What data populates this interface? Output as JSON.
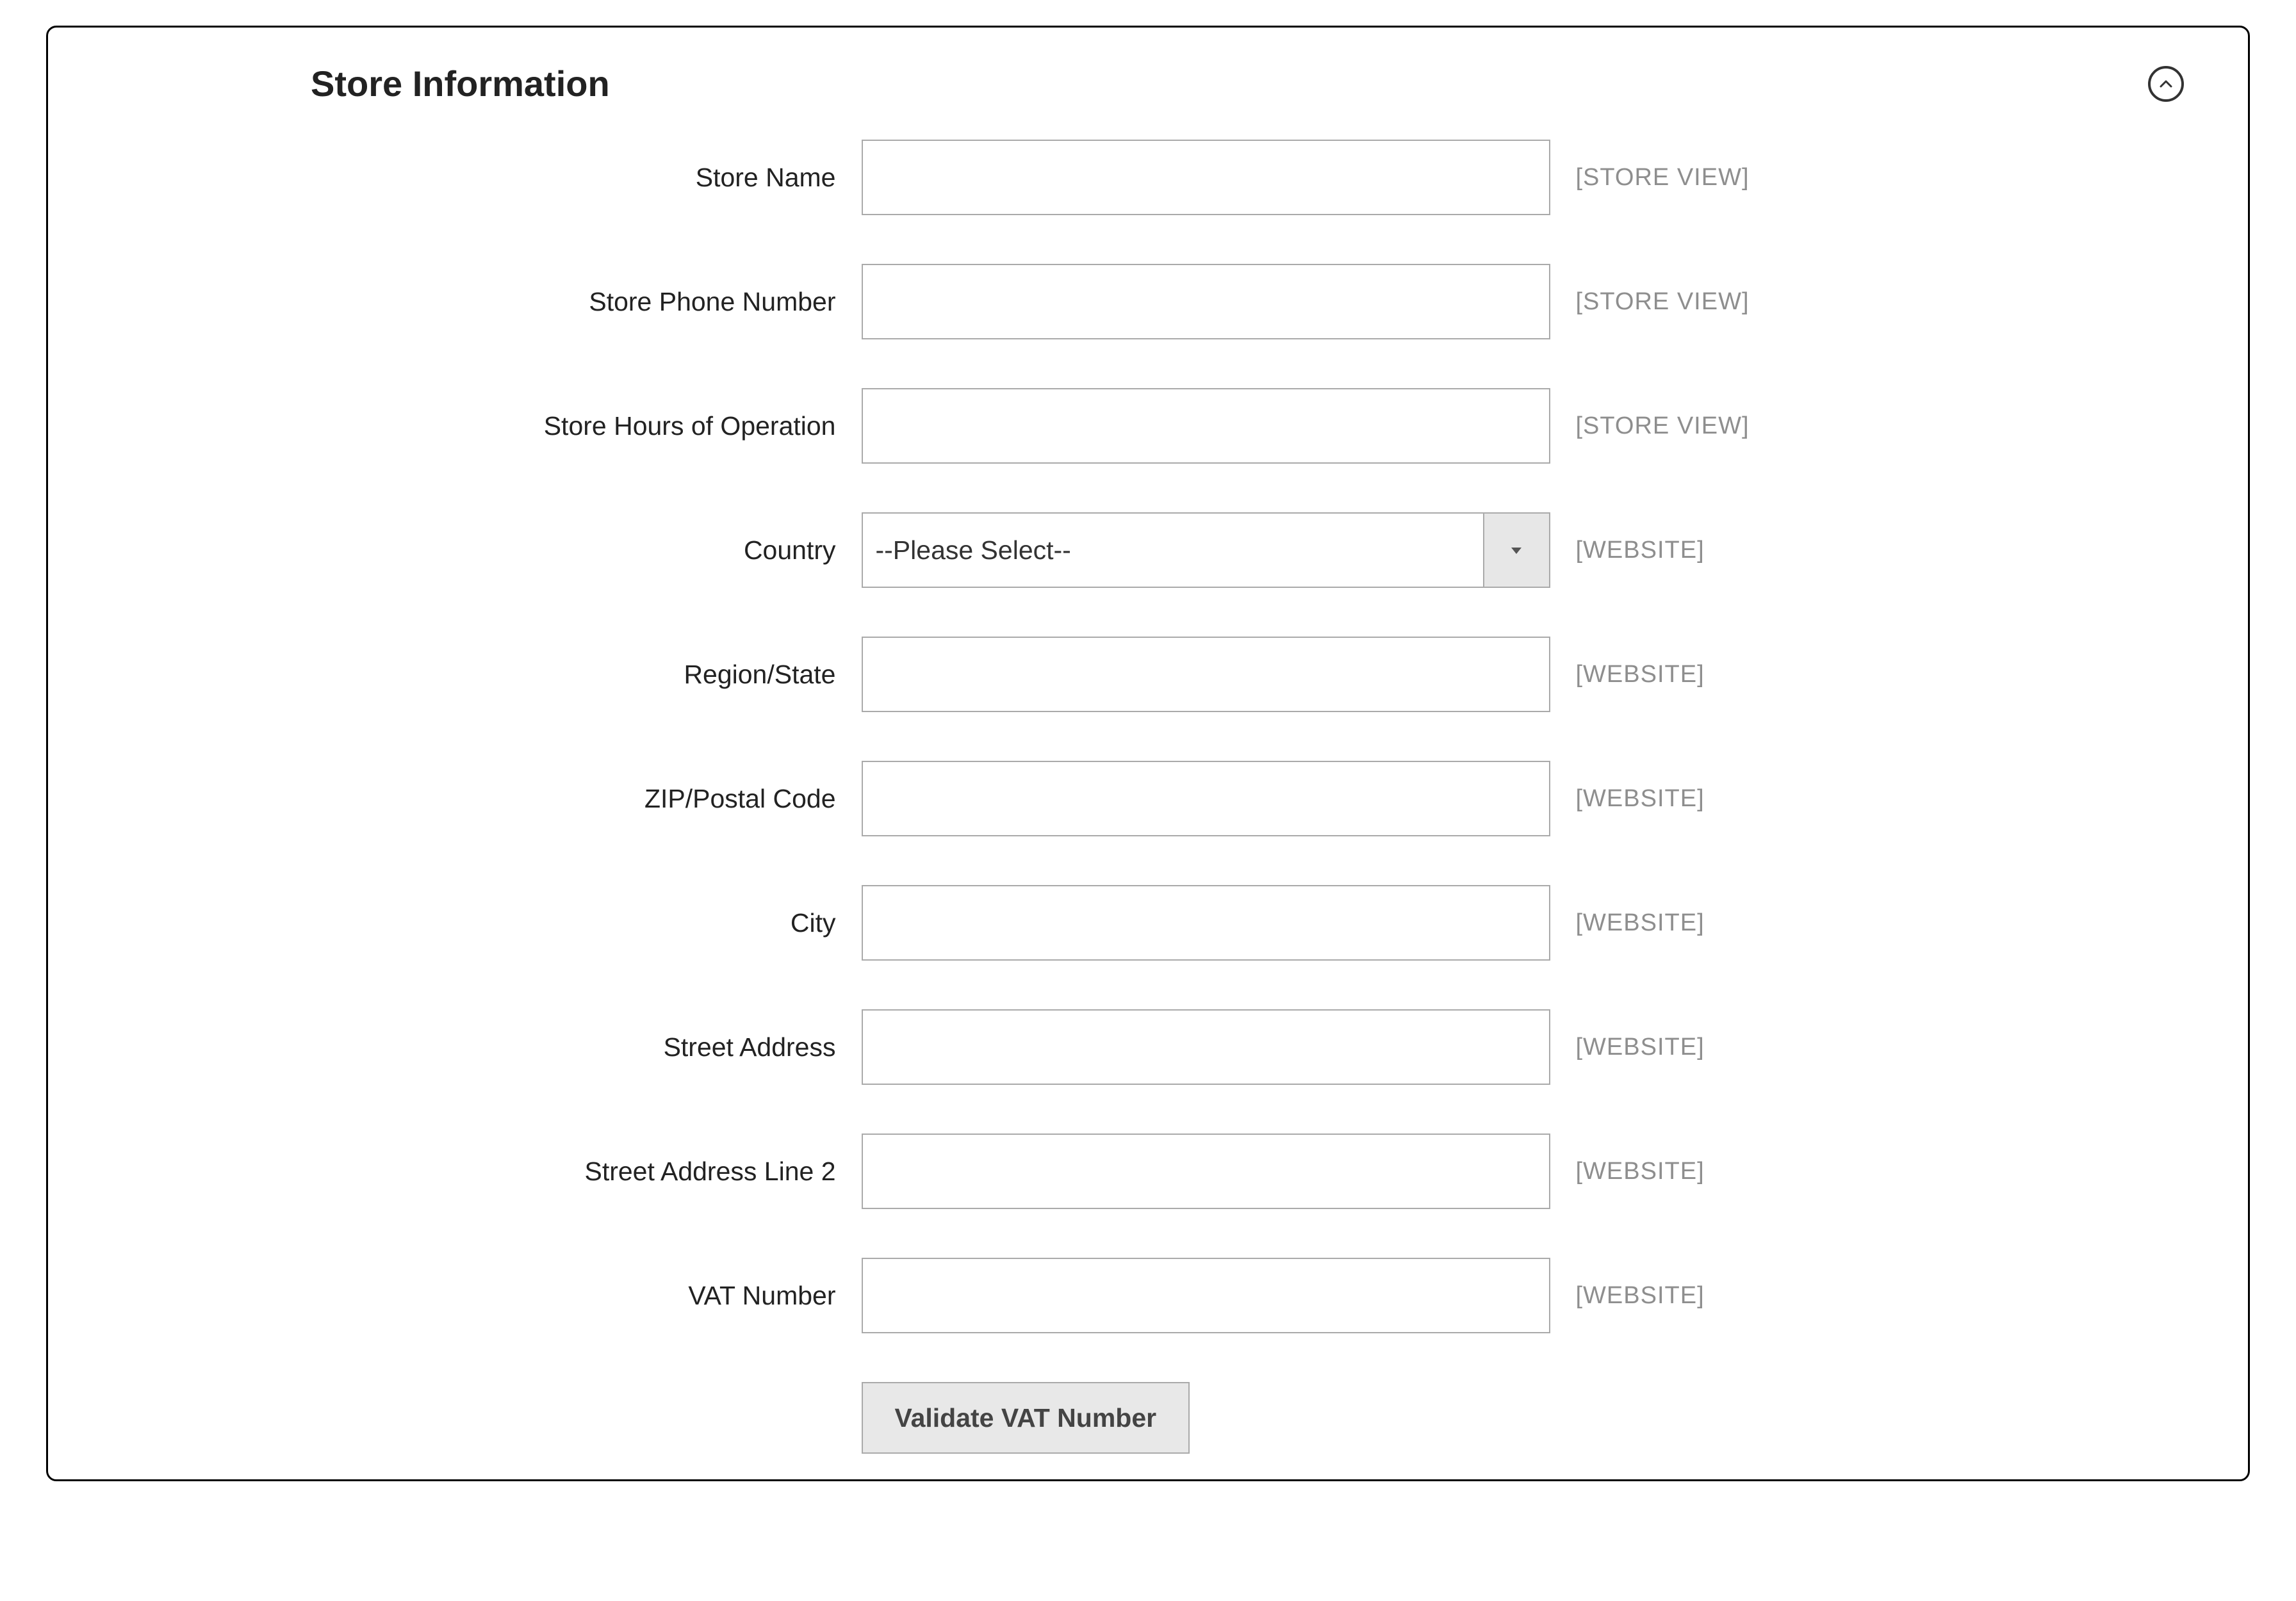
{
  "section": {
    "title": "Store Information"
  },
  "fields": {
    "store_name": {
      "label": "Store Name",
      "value": "",
      "scope": "[STORE VIEW]"
    },
    "store_phone": {
      "label": "Store Phone Number",
      "value": "",
      "scope": "[STORE VIEW]"
    },
    "store_hours": {
      "label": "Store Hours of Operation",
      "value": "",
      "scope": "[STORE VIEW]"
    },
    "country": {
      "label": "Country",
      "value": "--Please Select--",
      "scope": "[WEBSITE]"
    },
    "region_state": {
      "label": "Region/State",
      "value": "",
      "scope": "[WEBSITE]"
    },
    "zip": {
      "label": "ZIP/Postal Code",
      "value": "",
      "scope": "[WEBSITE]"
    },
    "city": {
      "label": "City",
      "value": "",
      "scope": "[WEBSITE]"
    },
    "street": {
      "label": "Street Address",
      "value": "",
      "scope": "[WEBSITE]"
    },
    "street2": {
      "label": "Street Address Line 2",
      "value": "",
      "scope": "[WEBSITE]"
    },
    "vat": {
      "label": "VAT Number",
      "value": "",
      "scope": "[WEBSITE]"
    }
  },
  "buttons": {
    "validate_vat": "Validate VAT Number"
  }
}
